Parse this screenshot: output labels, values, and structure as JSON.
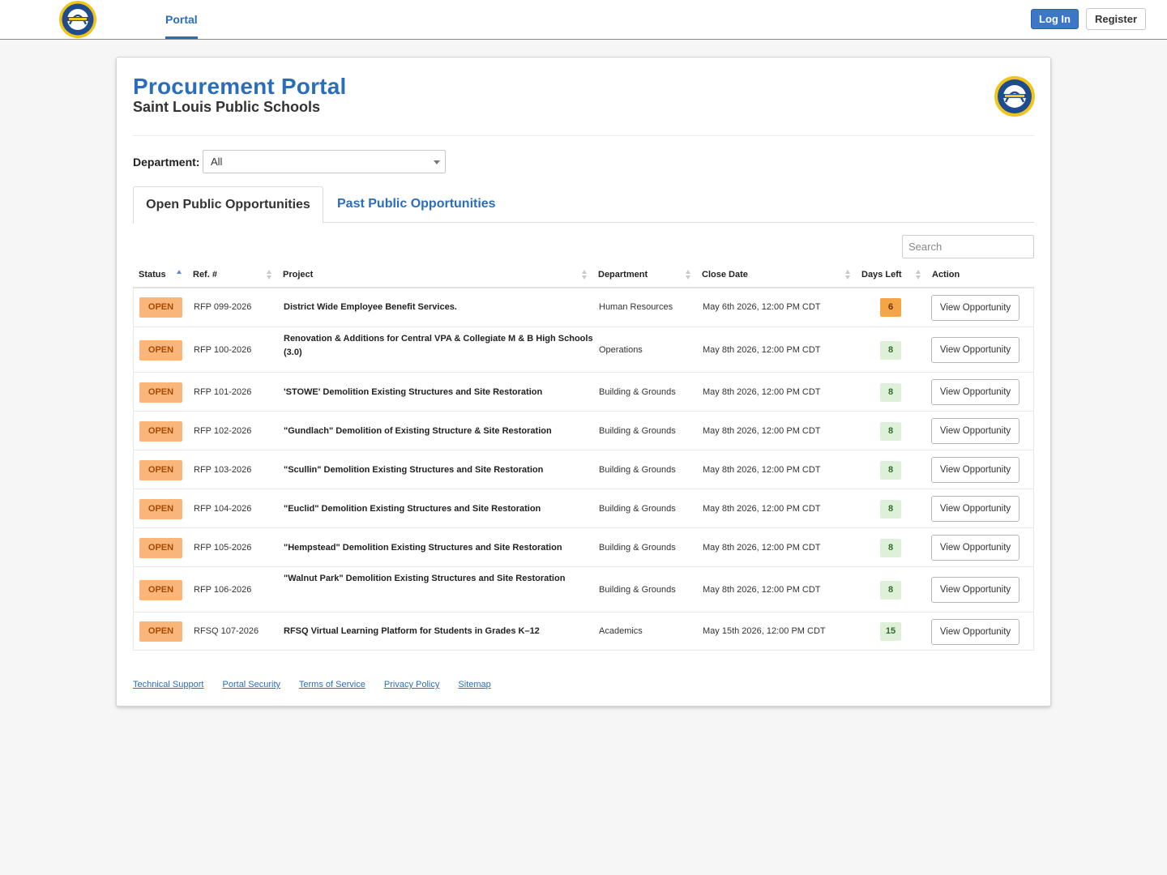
{
  "nav": {
    "portal_label": "Portal",
    "login_label": "Log In",
    "register_label": "Register"
  },
  "header": {
    "title": "Procurement Portal",
    "subtitle": "Saint Louis Public Schools"
  },
  "filter": {
    "department_label": "Department:",
    "department_value": "All"
  },
  "tabs": {
    "open_label": "Open Public Opportunities",
    "past_label": "Past Public Opportunities"
  },
  "search": {
    "placeholder": "Search"
  },
  "table": {
    "columns": [
      "Status",
      "Ref. #",
      "Project",
      "Department",
      "Close Date",
      "Days Left",
      "Action"
    ],
    "rows": [
      {
        "status": "OPEN",
        "ref": "RFP 099-2026",
        "project": "District Wide Employee Benefit Services.",
        "department": "Human Resources",
        "close_date": "May 6th 2026, 12:00 PM CDT",
        "days_left": "6",
        "action": "View Opportunity"
      },
      {
        "status": "OPEN",
        "ref": "RFP 100-2026",
        "project": "Renovation & Additions for Central VPA & Collegiate M & B High Schools (3.0)",
        "department": "Operations",
        "close_date": "May 8th 2026, 12:00 PM CDT",
        "days_left": "8",
        "action": "View Opportunity"
      },
      {
        "status": "OPEN",
        "ref": "RFP 101-2026",
        "project": "'STOWE' Demolition Existing Structures and Site Restoration",
        "department": "Building & Grounds",
        "close_date": "May 8th 2026, 12:00 PM CDT",
        "days_left": "8",
        "action": "View Opportunity"
      },
      {
        "status": "OPEN",
        "ref": "RFP 102-2026",
        "project": "\"Gundlach\" Demolition of Existing Structure & Site Restoration",
        "department": "Building & Grounds",
        "close_date": "May 8th 2026, 12:00 PM CDT",
        "days_left": "8",
        "action": "View Opportunity"
      },
      {
        "status": "OPEN",
        "ref": "RFP 103-2026",
        "project": "\"Scullin\" Demolition Existing Structures and Site Restoration",
        "department": "Building & Grounds",
        "close_date": "May 8th 2026, 12:00 PM CDT",
        "days_left": "8",
        "action": "View Opportunity"
      },
      {
        "status": "OPEN",
        "ref": "RFP 104-2026",
        "project": "\"Euclid\" Demolition Existing Structures and Site Restoration",
        "department": "Building & Grounds",
        "close_date": "May 8th 2026, 12:00 PM CDT",
        "days_left": "8",
        "action": "View Opportunity"
      },
      {
        "status": "OPEN",
        "ref": "RFP 105-2026",
        "project": "\"Hempstead\" Demolition Existing Structures and Site Restoration",
        "department": "Building & Grounds",
        "close_date": "May 8th 2026, 12:00 PM CDT",
        "days_left": "8",
        "action": "View Opportunity"
      },
      {
        "status": "OPEN",
        "ref": "RFP 106-2026",
        "project": "\"Walnut Park\" Demolition Existing Structures and Site Restoration",
        "department": "Building & Grounds",
        "close_date": "May 8th 2026, 12:00 PM CDT",
        "days_left": "8",
        "action": "View Opportunity"
      },
      {
        "status": "OPEN",
        "ref": "RFSQ 107-2026",
        "project": "RFSQ Virtual Learning Platform for Students in Grades K–12",
        "department": "Academics",
        "close_date": "May 15th 2026, 12:00 PM CDT",
        "days_left": "15",
        "action": "View Opportunity"
      }
    ]
  },
  "footer": {
    "links": [
      "Technical Support",
      "Portal Security",
      "Terms of Service",
      "Privacy Policy",
      "Sitemap"
    ]
  },
  "colors": {
    "brand_blue": "#2a6ebb",
    "open_badge": "#f9b57a",
    "days_warning": "#f5a545",
    "days_ok": "#dff0d8",
    "seal_gold": "#f0c419",
    "seal_navy": "#1f4c8f"
  }
}
